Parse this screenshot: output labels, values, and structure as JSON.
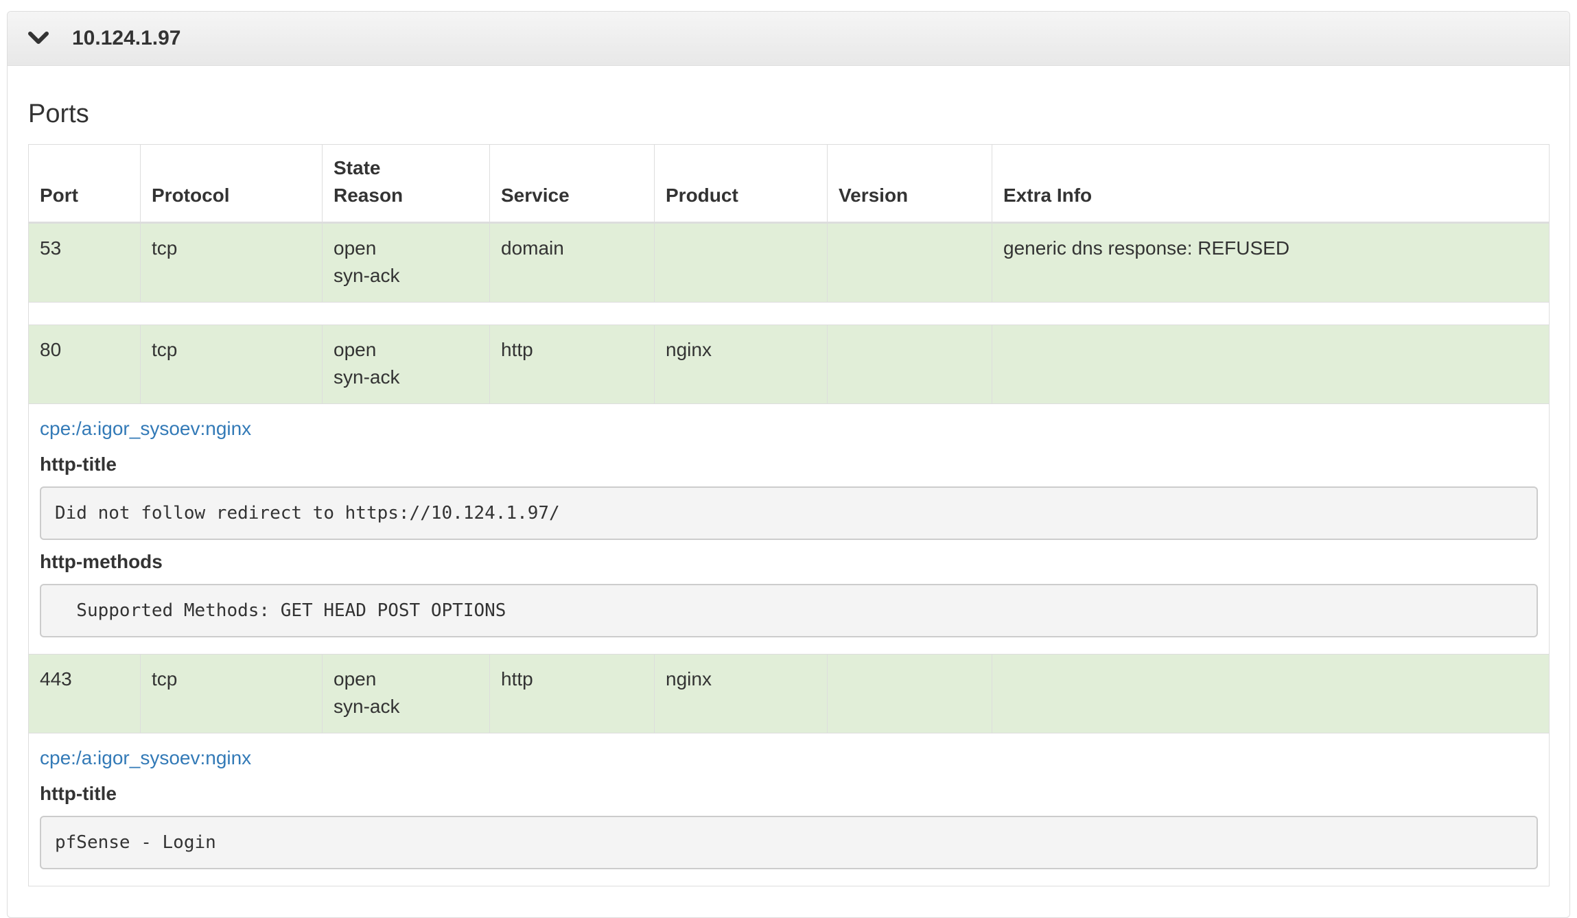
{
  "host": {
    "ip": "10.124.1.97"
  },
  "ports_section": {
    "title": "Ports",
    "columns": {
      "port": "Port",
      "protocol": "Protocol",
      "state": "State",
      "reason": "Reason",
      "service": "Service",
      "product": "Product",
      "version": "Version",
      "extra_info": "Extra Info"
    },
    "rows": [
      {
        "port": "53",
        "protocol": "tcp",
        "state": "open",
        "reason": "syn-ack",
        "service": "domain",
        "product": "",
        "version": "",
        "extra_info": "generic dns response: REFUSED"
      },
      {
        "port": "80",
        "protocol": "tcp",
        "state": "open",
        "reason": "syn-ack",
        "service": "http",
        "product": "nginx",
        "version": "",
        "extra_info": "",
        "cpe": "cpe:/a:igor_sysoev:nginx",
        "scripts": [
          {
            "name": "http-title",
            "output": "Did not follow redirect to https://10.124.1.97/"
          },
          {
            "name": "http-methods",
            "output": "  Supported Methods: GET HEAD POST OPTIONS"
          }
        ]
      },
      {
        "port": "443",
        "protocol": "tcp",
        "state": "open",
        "reason": "syn-ack",
        "service": "http",
        "product": "nginx",
        "version": "",
        "extra_info": "",
        "cpe": "cpe:/a:igor_sysoev:nginx",
        "scripts": [
          {
            "name": "http-title",
            "output": "pfSense - Login"
          }
        ]
      }
    ]
  },
  "icons": {
    "collapse": "chevron-down-icon"
  },
  "colors": {
    "open_row": "#e1eed8",
    "link": "#337ab7"
  }
}
